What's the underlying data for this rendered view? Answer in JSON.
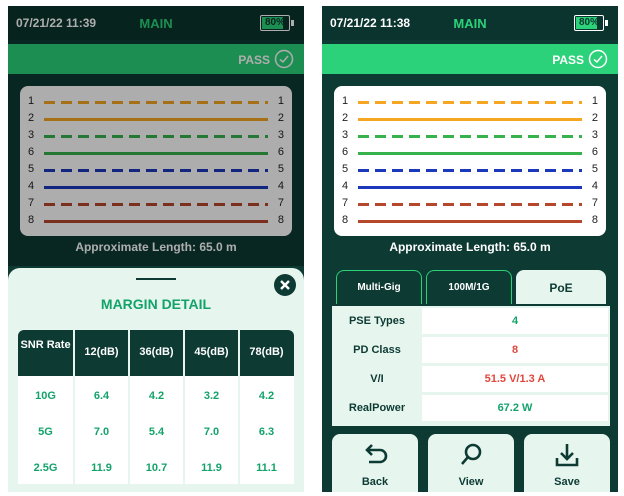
{
  "colors": {
    "background": "#0d3a33",
    "accent_green": "#2bd27a",
    "value_red": "#e0473d",
    "value_green": "#13a36a"
  },
  "screens": [
    {
      "status": {
        "time": "07/21/22 11:39",
        "title": "MAIN",
        "battery": "80%",
        "battery_level": 0.8
      },
      "pass_label": "PASS",
      "wiremap": [
        {
          "pin_left": "1",
          "pin_right": "1",
          "color": "#f5a623",
          "style": "dashed"
        },
        {
          "pin_left": "2",
          "pin_right": "2",
          "color": "#f5a623",
          "style": "solid"
        },
        {
          "pin_left": "3",
          "pin_right": "3",
          "color": "#37b24d",
          "style": "dashed"
        },
        {
          "pin_left": "6",
          "pin_right": "6",
          "color": "#37b24d",
          "style": "solid"
        },
        {
          "pin_left": "5",
          "pin_right": "5",
          "color": "#1c39bb",
          "style": "dashed"
        },
        {
          "pin_left": "4",
          "pin_right": "4",
          "color": "#1c39bb",
          "style": "solid"
        },
        {
          "pin_left": "7",
          "pin_right": "7",
          "color": "#b5482b",
          "style": "dashed"
        },
        {
          "pin_left": "8",
          "pin_right": "8",
          "color": "#b5482b",
          "style": "solid"
        }
      ],
      "approx_length": "Approximate Length: 65.0 m"
    },
    {
      "status": {
        "time": "07/21/22 11:38",
        "title": "MAIN",
        "battery": "80%",
        "battery_level": 0.8
      },
      "pass_label": "PASS",
      "wiremap": [
        {
          "pin_left": "1",
          "pin_right": "1",
          "color": "#f5a623",
          "style": "dashed"
        },
        {
          "pin_left": "2",
          "pin_right": "2",
          "color": "#f5a623",
          "style": "solid"
        },
        {
          "pin_left": "3",
          "pin_right": "3",
          "color": "#37b24d",
          "style": "dashed"
        },
        {
          "pin_left": "6",
          "pin_right": "6",
          "color": "#37b24d",
          "style": "solid"
        },
        {
          "pin_left": "5",
          "pin_right": "5",
          "color": "#1c39bb",
          "style": "dashed"
        },
        {
          "pin_left": "4",
          "pin_right": "4",
          "color": "#1c39bb",
          "style": "solid"
        },
        {
          "pin_left": "7",
          "pin_right": "7",
          "color": "#b5482b",
          "style": "dashed"
        },
        {
          "pin_left": "8",
          "pin_right": "8",
          "color": "#b5482b",
          "style": "solid"
        }
      ],
      "approx_length": "Approximate Length: 65.0 m"
    }
  ],
  "margin_detail": {
    "title": "MARGIN DETAIL",
    "headers": [
      "SNR Rate",
      "12(dB)",
      "36(dB)",
      "45(dB)",
      "78(dB)"
    ],
    "rows": [
      [
        "10G",
        "6.4",
        "4.2",
        "3.2",
        "4.2"
      ],
      [
        "5G",
        "7.0",
        "5.4",
        "7.0",
        "6.3"
      ],
      [
        "2.5G",
        "11.9",
        "10.7",
        "11.9",
        "11.1"
      ]
    ]
  },
  "poe": {
    "tabs": [
      {
        "label": "Multi-Gig",
        "active": false
      },
      {
        "label": "100M/1G",
        "active": false
      },
      {
        "label": "PoE",
        "active": true
      }
    ],
    "rows": [
      {
        "label": "PSE Types",
        "value": "4",
        "tone": "green"
      },
      {
        "label": "PD Class",
        "value": "8",
        "tone": "red"
      },
      {
        "label": "V/I",
        "value": "51.5 V/1.3 A",
        "tone": "red"
      },
      {
        "label": "RealPower",
        "value": "67.2 W",
        "tone": "green"
      }
    ]
  },
  "actions": [
    {
      "label": "Back",
      "icon": "back-arrow-icon"
    },
    {
      "label": "View",
      "icon": "magnifier-icon"
    },
    {
      "label": "Save",
      "icon": "download-icon"
    }
  ]
}
